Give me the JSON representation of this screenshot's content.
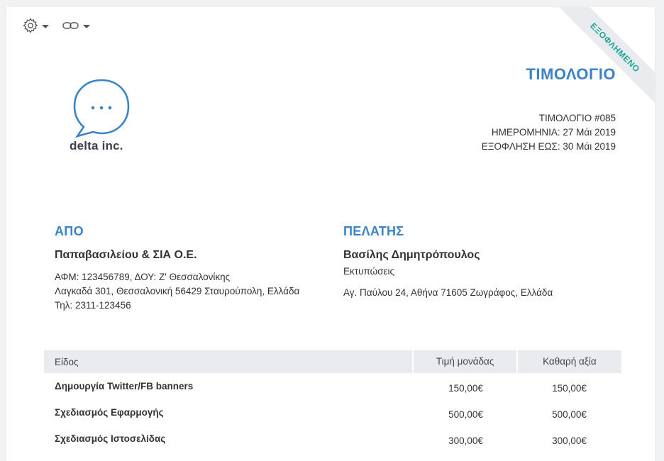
{
  "ribbon": {
    "label": "ΕΞΟΦΛΗΜΕΝΟ",
    "color": "#1aa89c"
  },
  "toolbar": {
    "settings_icon": "gear-icon",
    "link_icon": "link-icon"
  },
  "company": {
    "logo_text": "delta inc.",
    "logo_icon": "chat-bubble-icon",
    "brand_color": "#3b82c9"
  },
  "invoice": {
    "title": "ΤΙΜΟΛΟΓΙΟ",
    "number": "ΤΙΜΟΛΟΓΙΟ #085",
    "date": "ΗΜΕΡΟΜΗΝΙΑ: 27 Μάι 2019",
    "due": "ΕΞΟΦΛΗΣΗ ΕΩΣ: 30 Μάι 2019"
  },
  "from": {
    "heading": "ΑΠΟ",
    "name": "Παπαβασιλείου & ΣΙΑ Ο.Ε.",
    "tax": "ΑΦΜ: 123456789, ΔΟΥ: Ζ' Θεσσαλονίκης",
    "address": "Λαγκαδά 301, Θεσσαλονική 56429 Σταυρούπολη, Ελλάδα",
    "phone": "Τηλ: 2311-123456"
  },
  "to": {
    "heading": "ΠΕΛΑΤΗΣ",
    "name": "Βασίλης Δημητρόπουλος",
    "company": "Εκτυπώσεις",
    "address": "Αγ. Παύλου 24, Αθήνα 71605 Ζωγράφος, Ελλάδα"
  },
  "table": {
    "headers": [
      "Είδος",
      "Τιμή μονάδας",
      "Καθαρή αξία"
    ],
    "rows": [
      {
        "item": "Δημουργία Twitter/FB banners",
        "price": "150,00€",
        "total": "150,00€"
      },
      {
        "item": "Σχεδιασμός Εφαρμογής",
        "price": "500,00€",
        "total": "500,00€"
      },
      {
        "item": "Σχεδιασμός Ιστοσελίδας",
        "price": "300,00€",
        "total": "300,00€"
      }
    ]
  }
}
